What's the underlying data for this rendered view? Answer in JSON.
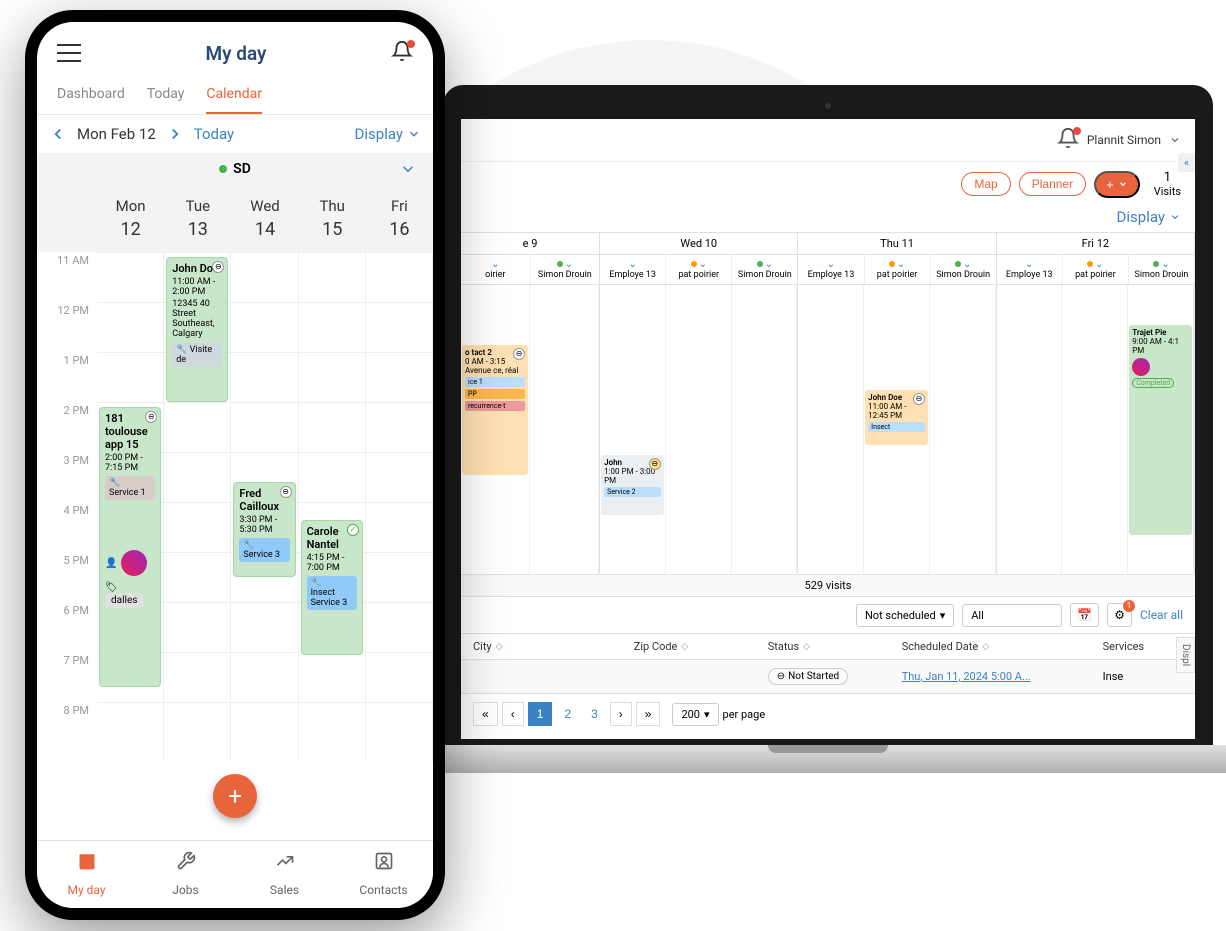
{
  "phone": {
    "title": "My day",
    "tabs": [
      "Dashboard",
      "Today",
      "Calendar"
    ],
    "active_tab": 2,
    "date": "Mon Feb 12",
    "today_label": "Today",
    "display_label": "Display",
    "user_initials": "SD",
    "week": [
      {
        "day": "Mon",
        "num": "12"
      },
      {
        "day": "Tue",
        "num": "13"
      },
      {
        "day": "Wed",
        "num": "14"
      },
      {
        "day": "Thu",
        "num": "15"
      },
      {
        "day": "Fri",
        "num": "16"
      }
    ],
    "time_slots": [
      "11 AM",
      "12 PM",
      "1 PM",
      "2 PM",
      "3 PM",
      "4 PM",
      "5 PM",
      "6 PM",
      "7 PM",
      "8 PM"
    ],
    "events": {
      "mon": {
        "title": "181 toulouse app 15",
        "time": "2:00 PM - 7:15 PM",
        "service": "Service 1",
        "chip": "dalles"
      },
      "tue": {
        "title": "John Do",
        "time": "11:00 AM - 2:00 PM",
        "address": "12345 40 Street Southeast, Calgary",
        "service": "Visite de"
      },
      "wed": {
        "title": "Fred Cailloux",
        "time": "3:30 PM - 5:30 PM",
        "service": "Service 3"
      },
      "thu": {
        "title": "Carole Nantel",
        "time": "4:15 PM - 7:00 PM",
        "service1": "Insect",
        "service2": "Service 3"
      }
    },
    "nav": [
      {
        "icon": "calendar-icon",
        "label": "My day",
        "glyph": "📅"
      },
      {
        "icon": "tools-icon",
        "label": "Jobs",
        "glyph": "🛠"
      },
      {
        "icon": "chart-icon",
        "label": "Sales",
        "glyph": "📈"
      },
      {
        "icon": "contacts-icon",
        "label": "Contacts",
        "glyph": "👤"
      }
    ]
  },
  "laptop": {
    "user": "Plannit Simon",
    "map_btn": "Map",
    "planner_btn": "Planner",
    "visits_num": "1",
    "visits_label": "Visits",
    "display_label": "Display",
    "days": [
      {
        "label": "e  9",
        "employees": [
          {
            "name": "oirier",
            "dot": ""
          },
          {
            "name": "Simon Drouin",
            "dot": "#4caf50"
          }
        ]
      },
      {
        "label": "Wed  10",
        "employees": [
          {
            "name": "Employe 13",
            "dot": ""
          },
          {
            "name": "pat poirier",
            "dot": "#ff9800"
          },
          {
            "name": "Simon Drouin",
            "dot": "#4caf50"
          }
        ]
      },
      {
        "label": "Thu  11",
        "employees": [
          {
            "name": "Employe 13",
            "dot": ""
          },
          {
            "name": "pat poirier",
            "dot": "#ff9800"
          },
          {
            "name": "Simon Drouin",
            "dot": "#4caf50"
          }
        ]
      },
      {
        "label": "Fri  12",
        "employees": [
          {
            "name": "Employe 13",
            "dot": ""
          },
          {
            "name": "pat poirier",
            "dot": "#ff9800"
          },
          {
            "name": "Simon Drouin",
            "dot": "#4caf50"
          }
        ]
      }
    ],
    "events": {
      "tue_contact": {
        "title": "o tact 2",
        "time": "0 AM - 3:15",
        "addr": "Avenue ce, réal",
        "chip1": "ice 1",
        "chip2": "PP",
        "chip3": "recurrence-t"
      },
      "wed_john": {
        "title": "John",
        "time": "1:00 PM - 3:00 PM",
        "service": "Service 2"
      },
      "thu_john": {
        "title": "John Doe",
        "time": "11:00 AM - 12:45 PM",
        "chip": "Insect"
      },
      "fri_trajet": {
        "title": "Trajet Pie",
        "time": "9:00 AM - 4:1 PM",
        "status": "Completed"
      }
    },
    "visits_count_bar": "529 visits",
    "filter_not_scheduled": "Not scheduled",
    "filter_all": "All",
    "clear_all": "Clear all",
    "columns": [
      "City",
      "Zip Code",
      "Status",
      "Scheduled Date",
      "Services"
    ],
    "row": {
      "status": "Not Started",
      "date": "Thu, Jan 11, 2024 5:00 A...",
      "service": "Inse"
    },
    "pagination": {
      "pages": [
        "1",
        "2",
        "3"
      ],
      "per_page": "200",
      "per_page_label": "per page"
    },
    "side_label": "Displ",
    "collapse_icon": "«"
  }
}
